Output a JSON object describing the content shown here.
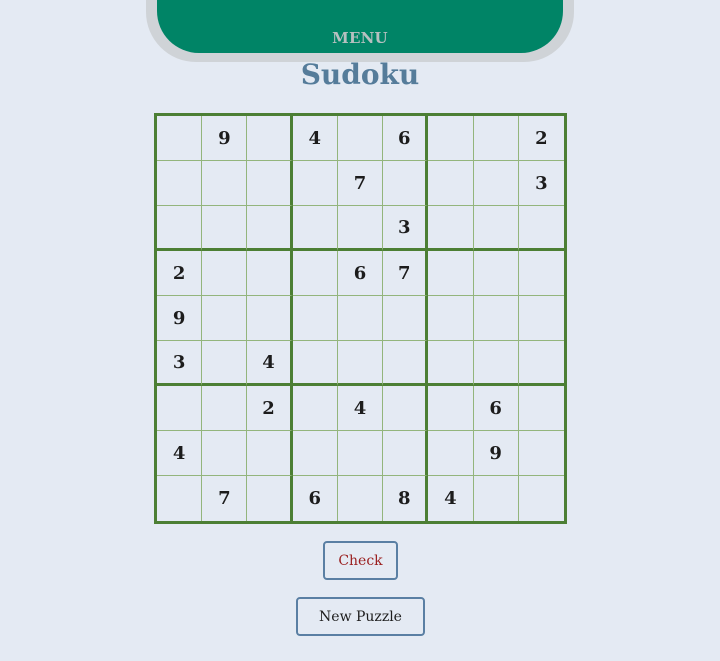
{
  "menu": {
    "label": "MENU"
  },
  "title": "Sudoku",
  "board": [
    [
      "",
      "9",
      "",
      "4",
      "",
      "6",
      "",
      "",
      "2"
    ],
    [
      "",
      "",
      "",
      "",
      "7",
      "",
      "",
      "",
      "3"
    ],
    [
      "",
      "",
      "",
      "",
      "",
      "3",
      "",
      "",
      ""
    ],
    [
      "2",
      "",
      "",
      "",
      "6",
      "7",
      "",
      "",
      ""
    ],
    [
      "9",
      "",
      "",
      "",
      "",
      "",
      "",
      "",
      ""
    ],
    [
      "3",
      "",
      "4",
      "",
      "",
      "",
      "",
      "",
      ""
    ],
    [
      "",
      "",
      "2",
      "",
      "4",
      "",
      "",
      "6",
      ""
    ],
    [
      "4",
      "",
      "",
      "",
      "",
      "",
      "",
      "9",
      ""
    ],
    [
      "",
      "7",
      "",
      "6",
      "",
      "8",
      "4",
      "",
      ""
    ]
  ],
  "buttons": {
    "check": "Check",
    "new_puzzle": "New Puzzle"
  },
  "colors": {
    "background": "#e4eaf3",
    "menu_bar": "#008466",
    "title": "#557c9a",
    "grid_thick": "#4c7f34",
    "grid_thin": "#93b57c",
    "check_text": "#9a1f1f"
  }
}
